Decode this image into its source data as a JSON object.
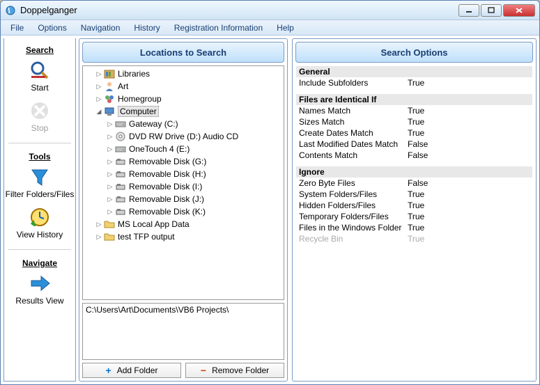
{
  "window": {
    "title": "Doppelganger"
  },
  "menubar": [
    "File",
    "Options",
    "Navigation",
    "History",
    "Registration Information",
    "Help"
  ],
  "sidebar": {
    "sections": [
      {
        "title": "Search",
        "items": [
          {
            "key": "start",
            "label": "Start",
            "icon": "magnifier-icon",
            "enabled": true
          },
          {
            "key": "stop",
            "label": "Stop",
            "icon": "stop-disabled-icon",
            "enabled": false
          }
        ]
      },
      {
        "title": "Tools",
        "items": [
          {
            "key": "filter",
            "label": "Filter Folders/Files",
            "icon": "funnel-icon",
            "enabled": true
          },
          {
            "key": "history",
            "label": "View History",
            "icon": "clock-icon",
            "enabled": true
          }
        ]
      },
      {
        "title": "Navigate",
        "items": [
          {
            "key": "results",
            "label": "Results View",
            "icon": "arrow-right-icon",
            "enabled": true
          }
        ]
      }
    ]
  },
  "locations": {
    "header": "Locations to Search",
    "tree": [
      {
        "label": "Libraries",
        "icon": "libraries-icon",
        "level": 1,
        "expander": "closed"
      },
      {
        "label": "Art",
        "icon": "user-icon",
        "level": 1,
        "expander": "closed"
      },
      {
        "label": "Homegroup",
        "icon": "homegroup-icon",
        "level": 1,
        "expander": "closed"
      },
      {
        "label": "Computer",
        "icon": "computer-icon",
        "level": 1,
        "expander": "open",
        "selected": true
      },
      {
        "label": "Gateway (C:)",
        "icon": "drive-icon",
        "level": 2,
        "expander": "closed"
      },
      {
        "label": "DVD RW Drive (D:) Audio CD",
        "icon": "dvd-icon",
        "level": 2,
        "expander": "closed"
      },
      {
        "label": "OneTouch 4 (E:)",
        "icon": "drive-icon",
        "level": 2,
        "expander": "closed"
      },
      {
        "label": "Removable Disk (G:)",
        "icon": "removable-icon",
        "level": 2,
        "expander": "closed"
      },
      {
        "label": "Removable Disk (H:)",
        "icon": "removable-icon",
        "level": 2,
        "expander": "closed"
      },
      {
        "label": "Removable Disk (I:)",
        "icon": "removable-icon",
        "level": 2,
        "expander": "closed"
      },
      {
        "label": "Removable Disk (J:)",
        "icon": "removable-icon",
        "level": 2,
        "expander": "closed"
      },
      {
        "label": "Removable Disk (K:)",
        "icon": "removable-icon",
        "level": 2,
        "expander": "closed"
      },
      {
        "label": "MS Local App Data",
        "icon": "folder-icon",
        "level": 1,
        "expander": "closed"
      },
      {
        "label": "test TFP output",
        "icon": "folder-icon",
        "level": 1,
        "expander": "closed"
      }
    ],
    "selected_path": "C:\\Users\\Art\\Documents\\VB6 Projects\\",
    "buttons": {
      "add": "Add Folder",
      "remove": "Remove Folder"
    }
  },
  "options": {
    "header": "Search Options",
    "groups": [
      {
        "heading": "General",
        "rows": [
          {
            "label": "Include Subfolders",
            "value": "True"
          }
        ]
      },
      {
        "heading": "Files are Identical If",
        "rows": [
          {
            "label": "Names Match",
            "value": "True"
          },
          {
            "label": "Sizes Match",
            "value": "True"
          },
          {
            "label": "Create Dates Match",
            "value": "True"
          },
          {
            "label": "Last Modified Dates Match",
            "value": "False"
          },
          {
            "label": "Contents Match",
            "value": "False"
          }
        ]
      },
      {
        "heading": "Ignore",
        "rows": [
          {
            "label": "Zero Byte Files",
            "value": "False"
          },
          {
            "label": "System Folders/Files",
            "value": "True"
          },
          {
            "label": "Hidden Folders/Files",
            "value": "True"
          },
          {
            "label": "Temporary Folders/Files",
            "value": "True"
          },
          {
            "label": "Files in the Windows Folder",
            "value": "True"
          },
          {
            "label": "Recycle Bin",
            "value": "True",
            "disabled": true
          }
        ]
      }
    ]
  },
  "icons": {
    "plus": "+",
    "minus": "−"
  }
}
